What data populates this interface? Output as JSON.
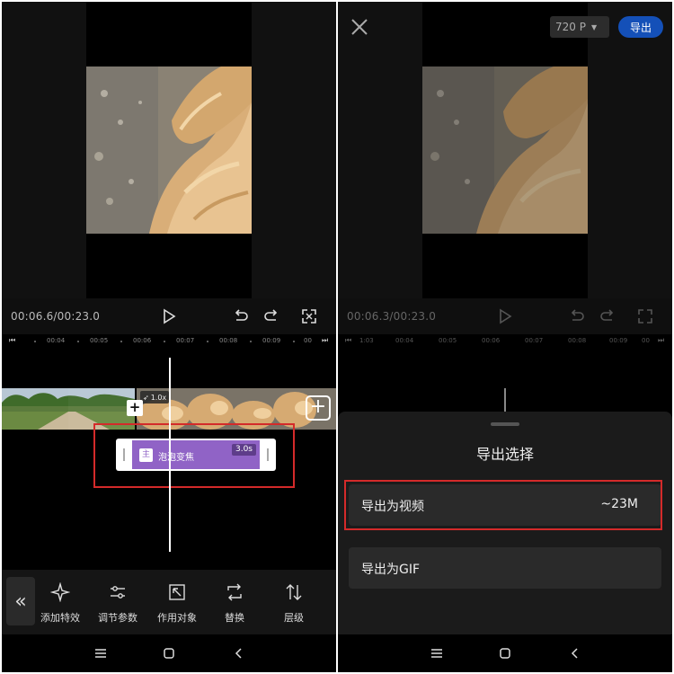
{
  "left_screen": {
    "controls": {
      "time": "00:06.6/00:23.0",
      "play_icon": "play-icon",
      "undo_icon": "undo-icon",
      "redo_icon": "redo-icon",
      "fullscreen_icon": "fullscreen-icon"
    },
    "ruler": {
      "start_icon": "skip-start-icon",
      "end_icon": "skip-end-icon",
      "ticks": [
        "00:04",
        "00:05",
        "00:06",
        "00:07",
        "00:08",
        "00:09",
        "00"
      ]
    },
    "timeline": {
      "speed_label": "1.0x",
      "effect": {
        "badge": "主",
        "name": "泡泡变焦",
        "duration": "3.0s"
      },
      "effect_color": "#9063c6",
      "highlight_color": "#d42a2a"
    },
    "toolbar": {
      "collapse_icon": "double-chevron-left-icon",
      "items": [
        {
          "label": "添加特效",
          "icon": "sparkle-icon"
        },
        {
          "label": "调节参数",
          "icon": "sliders-icon"
        },
        {
          "label": "作用对象",
          "icon": "target-object-icon"
        },
        {
          "label": "替换",
          "icon": "replace-icon"
        },
        {
          "label": "层级",
          "icon": "layer-order-icon"
        }
      ]
    }
  },
  "right_screen": {
    "header": {
      "close_icon": "close-icon",
      "resolution": "720 P",
      "export_label": "导出",
      "export_color": "#1450b8"
    },
    "controls": {
      "time": "00:06.3/00:23.0"
    },
    "ruler": {
      "ticks": [
        "1:03",
        "00:04",
        "00:05",
        "00:06",
        "00:07",
        "00:08",
        "00:09",
        "00"
      ]
    },
    "sheet": {
      "title": "导出选择",
      "options": [
        {
          "label": "导出为视频",
          "value": "~23M"
        },
        {
          "label": "导出为GIF",
          "value": ""
        }
      ]
    }
  },
  "navbar": {
    "menu_icon": "menu-icon",
    "home_icon": "home-icon",
    "back_icon": "back-icon"
  }
}
